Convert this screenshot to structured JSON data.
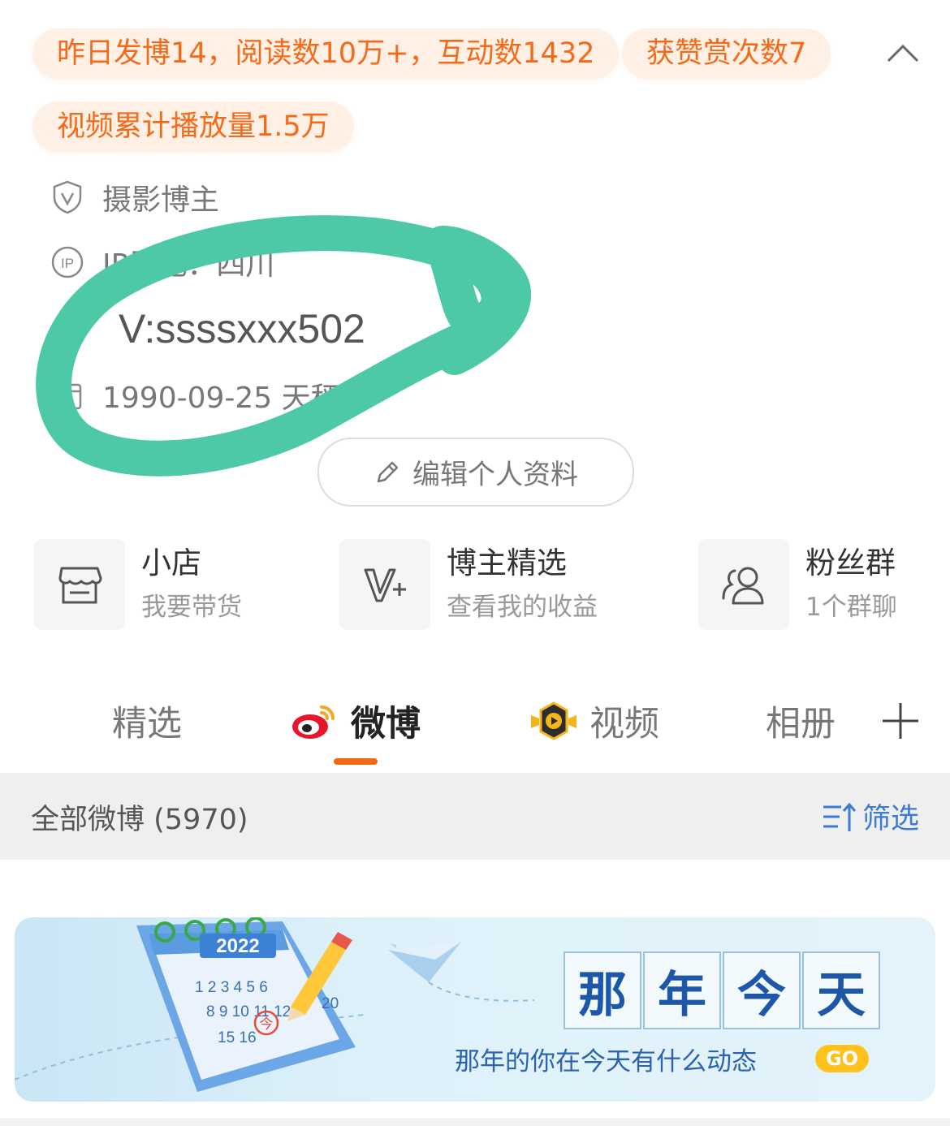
{
  "stats": {
    "yesterday": "昨日发博14，阅读数10万+，互动数1432",
    "likes": "获赞赏次数7",
    "video_plays": "视频累计播放量1.5万"
  },
  "profile": {
    "verification": "摄影博主",
    "ip_location": "IP属地：四川",
    "wechat": "V:ssssxxx502",
    "birthday": "1990-09-25 天秤座",
    "edit_button": "编辑个人资料"
  },
  "features": [
    {
      "title": "小店",
      "subtitle": "我要带货",
      "icon": "shop-icon"
    },
    {
      "title": "博主精选",
      "subtitle": "查看我的收益",
      "icon": "v-plus-icon"
    },
    {
      "title": "粉丝群",
      "subtitle": "1个群聊",
      "icon": "group-icon"
    }
  ],
  "tabs": [
    {
      "label": "精选",
      "active": false
    },
    {
      "label": "微博",
      "active": true,
      "icon": "weibo-logo-icon"
    },
    {
      "label": "视频",
      "active": false,
      "icon": "video-badge-icon"
    },
    {
      "label": "相册",
      "active": false
    }
  ],
  "filter": {
    "title": "全部微博 (5970)",
    "button": "筛选"
  },
  "banner": {
    "title_chars": [
      "那",
      "年",
      "今",
      "天"
    ],
    "subtitle": "那年的你在今天有什么动态",
    "go": "GO",
    "calendar_year": "2022",
    "calendar_numbers": "1 2 3 4 5 6",
    "calendar_row2": "8 9 10 11 12",
    "calendar_row3": "15 16",
    "calendar_day": "20",
    "calendar_today": "今"
  },
  "colors": {
    "accent": "#f46a18",
    "pill_bg": "#fff0e6",
    "tab_underline": "#f26a14",
    "filter_blue": "#3a7bd5",
    "scribble": "#4ec9a8"
  }
}
